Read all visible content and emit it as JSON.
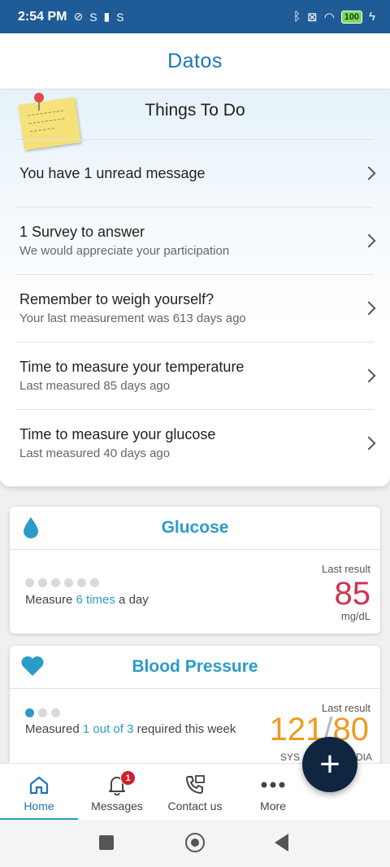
{
  "status_bar": {
    "time": "2:54 PM",
    "battery": "100"
  },
  "app": {
    "logo": "Datos"
  },
  "todo": {
    "title": "Things To Do",
    "items": [
      {
        "main": "You have 1 unread message",
        "sub": ""
      },
      {
        "main": "1 Survey to answer",
        "sub": "We would appreciate your participation"
      },
      {
        "main": "Remember to weigh yourself?",
        "sub": "Your last measurement was 613 days ago"
      },
      {
        "main": "Time to measure your temperature",
        "sub": "Last measured 85 days ago"
      },
      {
        "main": "Time to measure your glucose",
        "sub": "Last measured 40 days ago"
      }
    ]
  },
  "glucose": {
    "title": "Glucose",
    "text_before": "Measure ",
    "text_highlight": "6 times",
    "text_after": " a day",
    "last_result_label": "Last result",
    "value": "85",
    "unit": "mg/dL",
    "color": "#d0334e"
  },
  "blood_pressure": {
    "title": "Blood Pressure",
    "text_before": "Measured ",
    "text_highlight": "1 out of 3",
    "text_after": " required this week",
    "last_result_label": "Last result",
    "sys": "121",
    "separator": "/",
    "dia": "80",
    "sys_label": "SYS",
    "dia_label": "DIA",
    "color": "#ef9a1e"
  },
  "nav": {
    "items": [
      {
        "label": "Home"
      },
      {
        "label": "Messages",
        "badge": "1"
      },
      {
        "label": "Contact us"
      },
      {
        "label": "More"
      }
    ],
    "active": "Home"
  },
  "fab": {
    "symbol": "+"
  },
  "colors": {
    "accent": "#2b9bc7",
    "status_bar": "#1f5c97",
    "fab": "#0f2540"
  }
}
